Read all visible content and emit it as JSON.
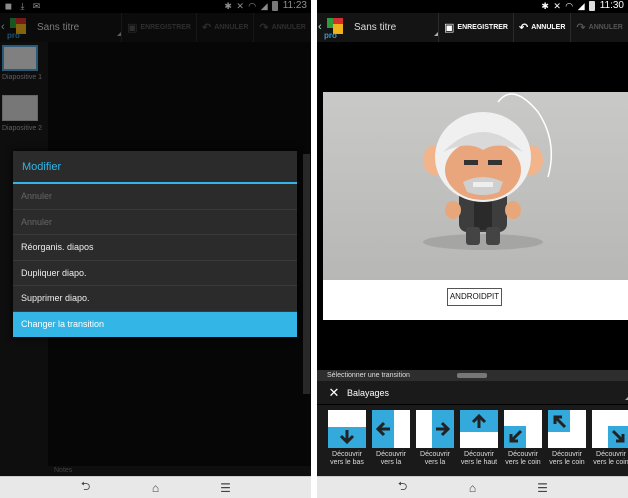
{
  "left": {
    "status": {
      "time": "11:23"
    },
    "actionbar": {
      "title": "Sans titre",
      "save": "ENREGISTRER",
      "undo": "ANNULER",
      "redo": "ANNULER"
    },
    "thumbnails": [
      {
        "label": "Diapositive 1"
      },
      {
        "label": "Diapositive 2"
      }
    ],
    "notes": "Notes",
    "dialog": {
      "title": "Modifier",
      "items": [
        {
          "label": "Annuler",
          "state": "disabled"
        },
        {
          "label": "Annuler",
          "state": "disabled"
        },
        {
          "label": "Réorganis. diapos",
          "state": "enabled"
        },
        {
          "label": "Dupliquer diapo.",
          "state": "enabled"
        },
        {
          "label": "Supprimer diapo.",
          "state": "enabled"
        },
        {
          "label": "Changer la transition",
          "state": "selected"
        }
      ]
    }
  },
  "right": {
    "status": {
      "time": "11:30"
    },
    "actionbar": {
      "title": "Sans titre",
      "save": "ENREGISTRER",
      "undo": "ANNULER",
      "redo": "ANNULER"
    },
    "slide_caption": "ANDROIDPIT",
    "transition_panel": {
      "header": "Sélectionner une transition",
      "category": "Balayages",
      "items": [
        {
          "label1": "Découvrir",
          "label2": "vers le bas",
          "arrow": "down"
        },
        {
          "label1": "Découvrir",
          "label2": "vers la",
          "arrow": "left"
        },
        {
          "label1": "Découvrir",
          "label2": "vers la",
          "arrow": "right"
        },
        {
          "label1": "Découvrir",
          "label2": "vers le haut",
          "arrow": "up"
        },
        {
          "label1": "Découvrir",
          "label2": "vers le coin",
          "arrow": "down-left"
        },
        {
          "label1": "Découvrir",
          "label2": "vers le coin",
          "arrow": "up-left"
        },
        {
          "label1": "Découvrir",
          "label2": "vers le coin",
          "arrow": "down-right"
        }
      ]
    }
  },
  "colors": {
    "accent": "#33b5e5",
    "menu_bg": "#2b2b2b",
    "selected_bg": "#33b5e5"
  },
  "icons": [
    "bluetooth-icon",
    "mute-icon",
    "wifi-icon",
    "signal-icon",
    "battery-icon",
    "usb-icon",
    "download-icon",
    "mail-icon",
    "save-icon",
    "undo-icon",
    "redo-icon",
    "close-icon",
    "back-icon",
    "home-icon",
    "menu-icon"
  ]
}
